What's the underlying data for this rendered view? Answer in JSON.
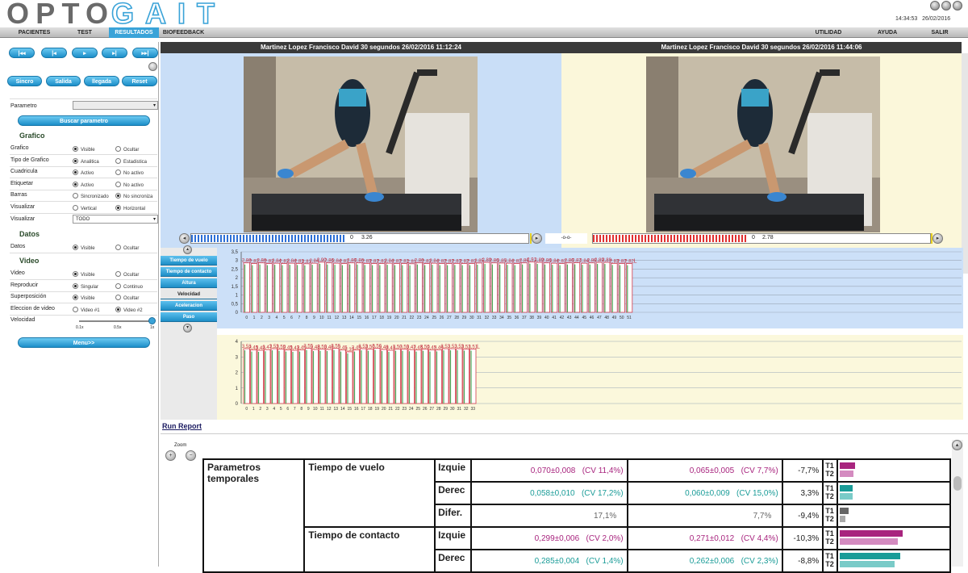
{
  "app": {
    "logo": "OPTOGAIT",
    "time": "14:34:53",
    "date": "26/02/2016"
  },
  "menu": {
    "left": [
      "PACIENTES",
      "TEST",
      "RESULTADOS",
      "BIOFEEDBACK"
    ],
    "active": "RESULTADOS",
    "right": [
      "UTILIDAD",
      "AYUDA",
      "SALIR"
    ]
  },
  "sidebar": {
    "transport": [
      "|◂◂",
      "|◂",
      "▸",
      "▸|",
      "▸▸|"
    ],
    "sync_buttons": [
      "Sincro",
      "Salida",
      "llegada",
      "Reset"
    ],
    "parametro_label": "Parametro",
    "parametro_value": "",
    "buscar_label": "Buscar parametro",
    "grafico_title": "Grafico",
    "grafico_rows": [
      {
        "label": "Grafico",
        "opt1": "Visible",
        "opt2": "Ocultar",
        "selected": 1
      },
      {
        "label": "Tipo de Grafico",
        "opt1": "Analitica",
        "opt2": "Estadistica",
        "selected": 1
      },
      {
        "label": "Cuadricula",
        "opt1": "Activo",
        "opt2": "No activo",
        "selected": 1
      },
      {
        "label": "Etiquetar",
        "opt1": "Activo",
        "opt2": "No activo",
        "selected": 1
      },
      {
        "label": "Barras",
        "opt1": "Sincronizado",
        "opt2": "No sincroniza",
        "selected": 2
      },
      {
        "label": "Visualizar",
        "opt1": "Vertical",
        "opt2": "Horizontal",
        "selected": 2
      }
    ],
    "visualizar_label": "Visualizar",
    "visualizar_value": "TODO",
    "datos_title": "Datos",
    "datos_row": {
      "label": "Datos",
      "opt1": "Visible",
      "opt2": "Ocultar",
      "selected": 1
    },
    "video_title": "Video",
    "video_rows": [
      {
        "label": "Video",
        "opt1": "Visible",
        "opt2": "Ocultar",
        "selected": 1
      },
      {
        "label": "Reproducir",
        "opt1": "Singular",
        "opt2": "Continuo",
        "selected": 1
      },
      {
        "label": "Superposición",
        "opt1": "Visible",
        "opt2": "Ocultar",
        "selected": 1
      },
      {
        "label": "Eleccion de video",
        "opt1": "Video #1",
        "opt2": "Video #2",
        "selected": 2
      }
    ],
    "velocidad_label": "Velocidad",
    "velocidad_ticks": [
      "0.1x",
      "0.5x",
      "1x"
    ],
    "velocidad_level": 1.0,
    "menu_label": "Menu>>"
  },
  "videos": [
    {
      "title": "Martinez Lopez Francisco David 30 segundos 26/02/2016 11:12:24",
      "timeline_value": "3.26",
      "timeline_prefix": "0",
      "progress": 0.96,
      "color": "#2d6fd6",
      "bg": "#c9def7"
    },
    {
      "title": "Martinez Lopez Francisco David 30 segundos 26/02/2016 11:44:06",
      "timeline_value": "2.78",
      "timeline_prefix": "0",
      "progress": 0.96,
      "color": "#e03030",
      "bg": "#fbf7da"
    }
  ],
  "sync_indicator": "-o-o-",
  "chart_tabs": [
    "Tiempo de vuelo",
    "Tiempo de contacto",
    "Altura",
    "Velocidad",
    "Aceleracion",
    "Paso"
  ],
  "chart_tab_selected": "Velocidad",
  "chart_data": [
    {
      "type": "bar",
      "yticks": [
        "3,5",
        "3",
        "2,5",
        "2",
        "1,5",
        "1",
        "0,5",
        "0"
      ],
      "ylim": [
        0,
        3.5
      ],
      "grid": true,
      "bar_fill": "#ffffff",
      "bar_stroke": "#d23a4a",
      "values": [
        2.86,
        2.82,
        2.86,
        2.82,
        2.84,
        2.82,
        2.84,
        2.83,
        2.81,
        2.84,
        2.9,
        2.86,
        2.84,
        2.82,
        2.86,
        2.86,
        2.83,
        2.82,
        2.82,
        2.84,
        2.82,
        2.82,
        2.81,
        2.86,
        2.82,
        2.84,
        2.82,
        2.82,
        2.83,
        2.82,
        2.82,
        2.85,
        2.89,
        2.86,
        2.85,
        2.84,
        2.82,
        2.86,
        2.91,
        2.89,
        2.86,
        2.84,
        2.82,
        2.86,
        2.87,
        2.84,
        2.86,
        2.89,
        2.89,
        2.83,
        2.82,
        2.82
      ],
      "labels": [
        "2,86",
        "2,82",
        "2,86",
        "2,82",
        "2,84",
        "2,82",
        "2,84",
        "2,83",
        "2,81",
        "2,84",
        "2,90",
        "2,86",
        "2,84",
        "2,82",
        "2,86",
        "2,86",
        "2,83",
        "2,82",
        "2,82",
        "2,84",
        "2,82",
        "2,82",
        "2,81",
        "2,86",
        "2,82",
        "2,84",
        "2,82",
        "2,82",
        "2,83",
        "2,82",
        "2,82",
        "2,85",
        "2,89",
        "2,86",
        "2,85",
        "2,84",
        "2,82",
        "2,86",
        "2,91",
        "2,89",
        "2,86",
        "2,84",
        "2,82",
        "2,86",
        "2,87",
        "2,84",
        "2,86",
        "2,89",
        "2,89",
        "2,83",
        "2,82",
        "2,82"
      ],
      "end_label": "L"
    },
    {
      "type": "bar",
      "yticks": [
        "4",
        "3",
        "2",
        "1",
        "0"
      ],
      "ylim": [
        0,
        4
      ],
      "grid": true,
      "bar_fill": "#ffffff",
      "bar_stroke": "#d23a4a",
      "values": [
        3.53,
        3.45,
        3.43,
        3.47,
        3.53,
        3.5,
        3.45,
        3.43,
        3.45,
        3.55,
        3.48,
        3.5,
        3.48,
        3.55,
        3.45,
        3.33,
        3.45,
        3.53,
        3.5,
        3.56,
        3.48,
        3.43,
        3.5,
        3.5,
        3.47,
        3.45,
        3.5,
        3.45,
        3.46,
        3.53,
        3.53,
        3.53,
        3.51,
        3.51
      ],
      "labels": [
        "3,53",
        "3,45",
        "3,43",
        "3,47",
        "3,53",
        "3,50",
        "3,45",
        "3,43",
        "3,45",
        "3,55",
        "3,48",
        "3,50",
        "3,48",
        "3,55",
        "3,45",
        "3,33",
        "3,45",
        "3,53",
        "3,50",
        "3,56",
        "3,48",
        "3,43",
        "3,50",
        "3,50",
        "3,47",
        "3,45",
        "3,50",
        "3,45",
        "3,46",
        "3,53",
        "3,53",
        "3,53",
        "3,51",
        "3,51"
      ],
      "end_label": "L"
    }
  ],
  "run_report": "Run Report",
  "zoom_label": "Zoom",
  "report": {
    "group": "Parametros temporales",
    "rows": [
      {
        "param": "Tiempo de vuelo",
        "side": "Izquie",
        "v1": "0,070±0,008",
        "cv1": "(CV 11,4%)",
        "v2": "0,065±0,005",
        "cv2": "(CV 7,7%)",
        "pct": "-7,7%",
        "color": "#a8247e",
        "b1": 0.14,
        "b2": 0.13,
        "light": "#d48bc0"
      },
      {
        "param": "",
        "side": "Derec",
        "v1": "0,058±0,010",
        "cv1": "(CV 17,2%)",
        "v2": "0,060±0,009",
        "cv2": "(CV 15,0%)",
        "pct": "3,3%",
        "color": "#1a9c98",
        "b1": 0.12,
        "b2": 0.12,
        "light": "#7acbc8"
      },
      {
        "param": "",
        "side": "Difer.",
        "v1": "17,1%",
        "cv1": "",
        "v2": "7,7%",
        "cv2": "",
        "pct": "-9,4%",
        "color": "#666666",
        "b1": 0.08,
        "b2": 0.05,
        "light": "#aaaaaa"
      },
      {
        "param": "Tiempo de contacto",
        "side": "Izquie",
        "v1": "0,299±0,006",
        "cv1": "(CV 2,0%)",
        "v2": "0,271±0,012",
        "cv2": "(CV 4,4%)",
        "pct": "-10,3%",
        "color": "#a8247e",
        "b1": 0.6,
        "b2": 0.55,
        "light": "#d48bc0"
      },
      {
        "param": "",
        "side": "Derec",
        "v1": "0,285±0,004",
        "cv1": "(CV 1,4%)",
        "v2": "0,262±0,006",
        "cv2": "(CV 2,3%)",
        "pct": "-8,8%",
        "color": "#1a9c98",
        "b1": 0.57,
        "b2": 0.52,
        "light": "#7acbc8"
      }
    ],
    "t1": "T1",
    "t2": "T2"
  }
}
